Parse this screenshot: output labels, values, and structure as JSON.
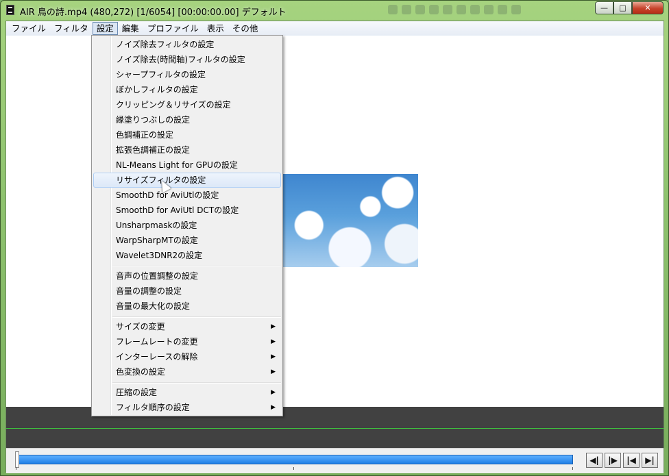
{
  "window": {
    "title": "AIR 鳥の詩.mp4 (480,272)  [1/6054] [00:00:00.00]  デフォルト",
    "buttons": {
      "minimize": "—",
      "maximize": "□",
      "close": "✕"
    }
  },
  "menubar": {
    "items": [
      {
        "label": "ファイル"
      },
      {
        "label": "フィルタ"
      },
      {
        "label": "設定"
      },
      {
        "label": "編集"
      },
      {
        "label": "プロファイル"
      },
      {
        "label": "表示"
      },
      {
        "label": "その他"
      }
    ],
    "active_index": 2
  },
  "dropdown": {
    "items": [
      {
        "label": "ノイズ除去フィルタの設定"
      },
      {
        "label": "ノイズ除去(時間軸)フィルタの設定"
      },
      {
        "label": "シャープフィルタの設定"
      },
      {
        "label": "ぼかしフィルタの設定"
      },
      {
        "label": "クリッピング＆リサイズの設定"
      },
      {
        "label": "縁塗りつぶしの設定"
      },
      {
        "label": "色調補正の設定"
      },
      {
        "label": "拡張色調補正の設定"
      },
      {
        "label": "NL-Means Light for GPUの設定"
      },
      {
        "label": "リサイズフィルタの設定"
      },
      {
        "label": "SmoothD for AviUtlの設定"
      },
      {
        "label": "SmoothD for AviUtl DCTの設定"
      },
      {
        "label": "Unsharpmaskの設定"
      },
      {
        "label": "WarpSharpMTの設定"
      },
      {
        "label": "Wavelet3DNR2の設定"
      },
      {
        "label": "音声の位置調整の設定"
      },
      {
        "label": "音量の調整の設定"
      },
      {
        "label": "音量の最大化の設定"
      },
      {
        "label": "サイズの変更",
        "submenu": true
      },
      {
        "label": "フレームレートの変更",
        "submenu": true
      },
      {
        "label": "インターレースの解除",
        "submenu": true
      },
      {
        "label": "色変換の設定",
        "submenu": true
      },
      {
        "label": "圧縮の設定",
        "submenu": true
      },
      {
        "label": "フィルタ順序の設定",
        "submenu": true
      }
    ],
    "hover_index": 9,
    "submenu_arrow": "▶"
  },
  "transport": {
    "prev_keyframe": "◀|",
    "next_keyframe": "|▶",
    "to_start": "|◀",
    "to_end": "▶|"
  }
}
